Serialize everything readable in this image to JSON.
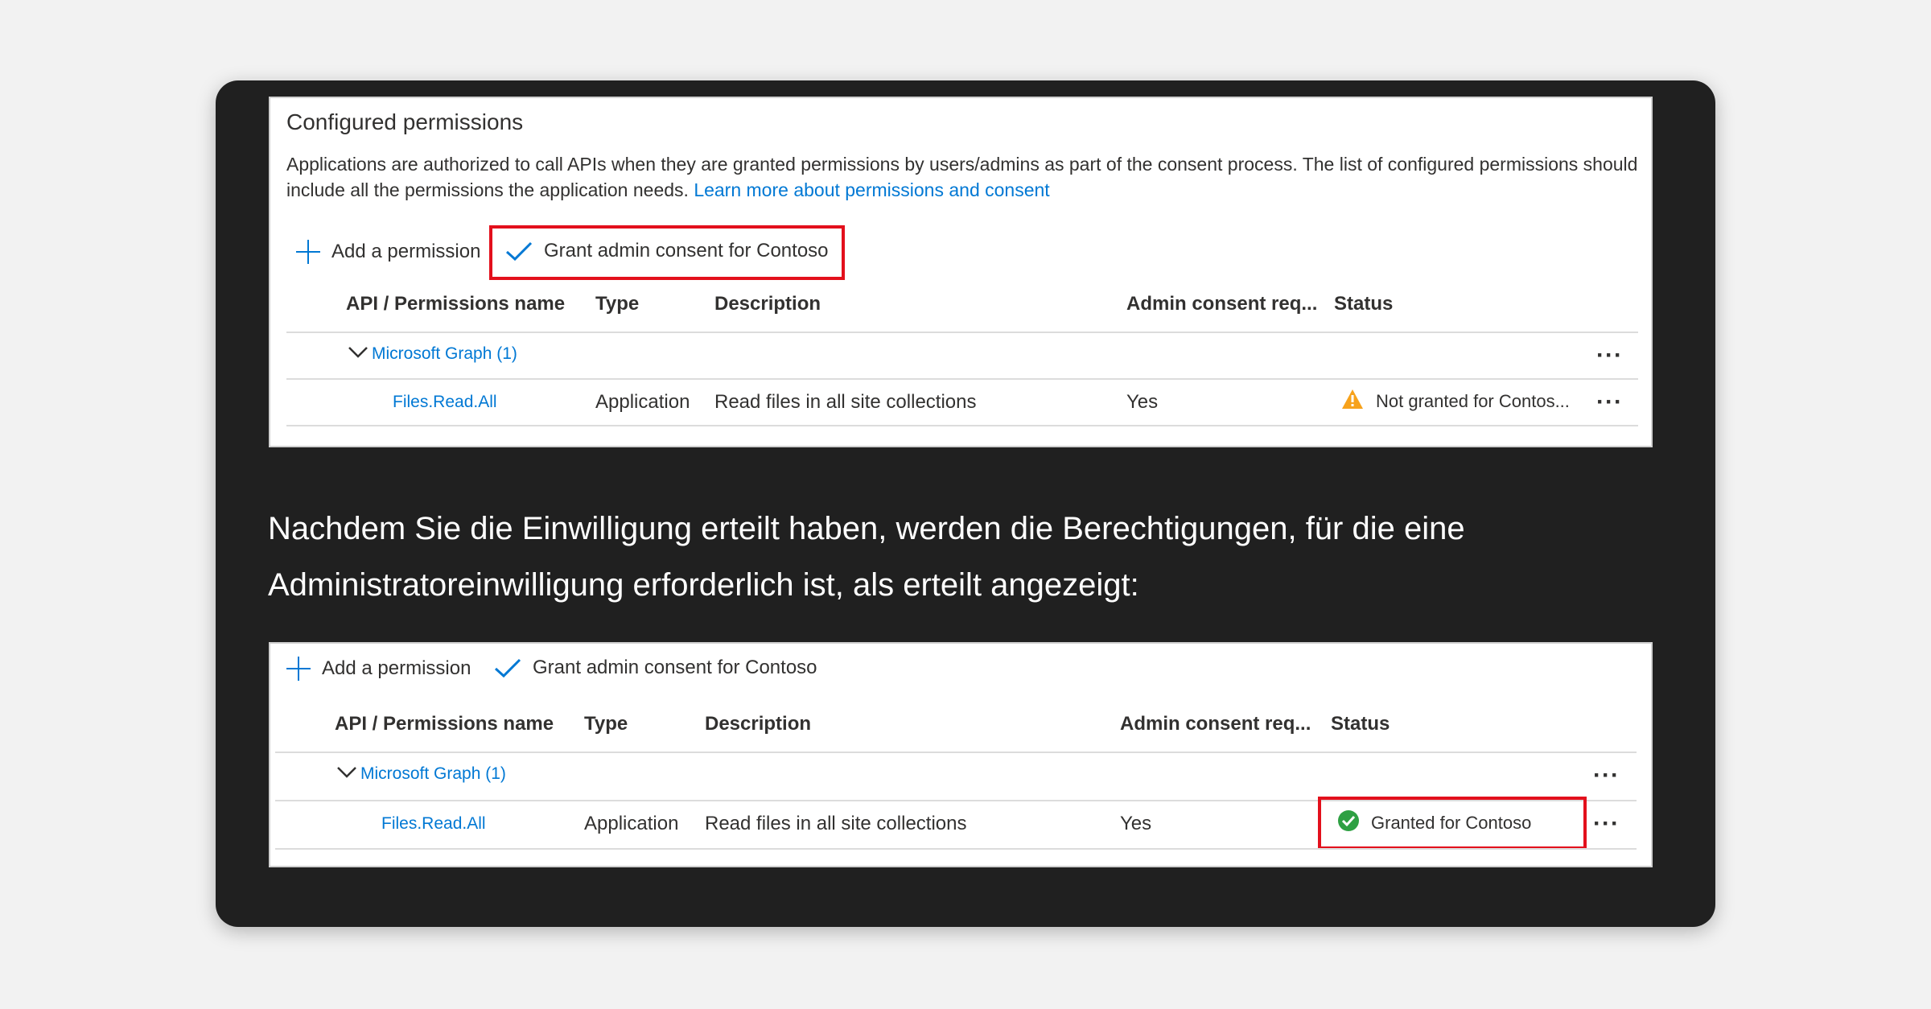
{
  "panel1": {
    "title": "Configured permissions",
    "description": "Applications are authorized to call APIs when they are granted permissions by users/admins as part of the consent process. The list of configured permissions should include all the permissions the application needs.",
    "link": "Learn more about permissions and consent",
    "toolbar": {
      "add_label": "Add a permission",
      "grant_label": "Grant admin consent for Contoso"
    },
    "columns": [
      "API / Permissions name",
      "Type",
      "Description",
      "Admin consent req...",
      "Status"
    ],
    "group": "Microsoft Graph (1)",
    "row": {
      "name": "Files.Read.All",
      "type": "Application",
      "description": "Read files in all site collections",
      "admin_consent": "Yes",
      "status": "Not granted for Contos..."
    }
  },
  "body_text": "Nachdem Sie die Einwilligung erteilt haben, werden die Berechtigungen, für die eine Administratoreinwilligung erforderlich ist, als erteilt angezeigt:",
  "panel2": {
    "toolbar": {
      "add_label": "Add a permission",
      "grant_label": "Grant admin consent for Contoso"
    },
    "columns": [
      "API / Permissions name",
      "Type",
      "Description",
      "Admin consent req...",
      "Status"
    ],
    "group": "Microsoft Graph (1)",
    "row": {
      "name": "Files.Read.All",
      "type": "Application",
      "description": "Read files in all site collections",
      "admin_consent": "Yes",
      "status": "Granted for Contoso"
    }
  },
  "icons": {
    "add": "plus-icon",
    "grant": "checkmark-icon",
    "expand": "chevron-down-icon",
    "more": "more-options-icon",
    "warning": "warning-icon",
    "granted": "check-circle-icon"
  },
  "colors": {
    "card_background": "#202020",
    "page_background": "#f2f2f2",
    "link": "#0078d4",
    "highlight": "#e3101c",
    "warning": "#f7a21b",
    "success": "#2ea043"
  }
}
